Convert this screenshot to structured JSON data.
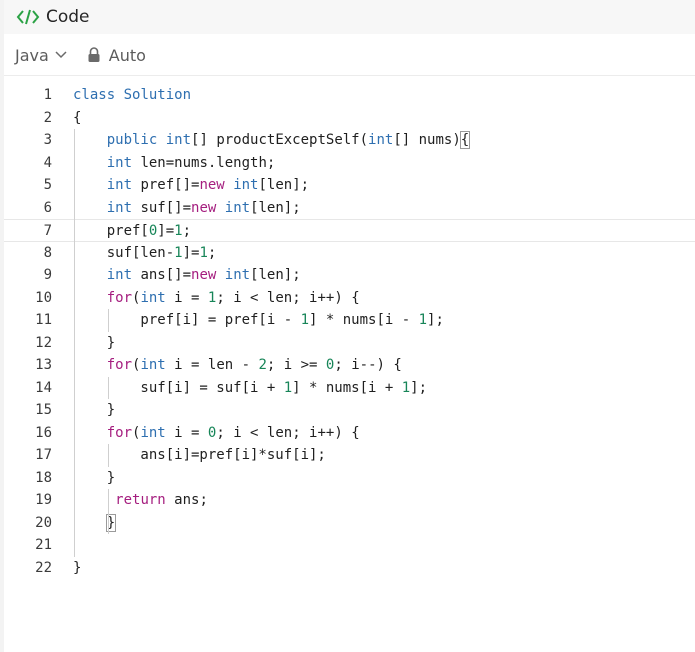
{
  "header": {
    "title": "Code",
    "icon": "code-brackets-icon",
    "icon_color": "#2ba245"
  },
  "toolbar": {
    "language": "Java",
    "mode": "Auto"
  },
  "editor": {
    "lines": [
      {
        "n": "1"
      },
      {
        "n": "2"
      },
      {
        "n": "3"
      },
      {
        "n": "4"
      },
      {
        "n": "5"
      },
      {
        "n": "6"
      },
      {
        "n": "7"
      },
      {
        "n": "8"
      },
      {
        "n": "9"
      },
      {
        "n": "10"
      },
      {
        "n": "11"
      },
      {
        "n": "12"
      },
      {
        "n": "13"
      },
      {
        "n": "14"
      },
      {
        "n": "15"
      },
      {
        "n": "16"
      },
      {
        "n": "17"
      },
      {
        "n": "18"
      },
      {
        "n": "19"
      },
      {
        "n": "20"
      },
      {
        "n": "21"
      },
      {
        "n": "22"
      }
    ],
    "tokens": [
      [
        [
          "kw",
          "class"
        ],
        [
          "",
          " "
        ],
        [
          "type",
          "Solution"
        ]
      ],
      [
        [
          "",
          "{"
        ]
      ],
      [
        [
          "",
          "    "
        ],
        [
          "kw",
          "public"
        ],
        [
          "",
          " "
        ],
        [
          "type",
          "int"
        ],
        [
          "",
          "[] productExceptSelf("
        ],
        [
          "type",
          "int"
        ],
        [
          "",
          "[] nums)"
        ],
        [
          "hl",
          "{"
        ]
      ],
      [
        [
          "",
          "    "
        ],
        [
          "type",
          "int"
        ],
        [
          "",
          " len=nums.length;"
        ]
      ],
      [
        [
          "",
          "    "
        ],
        [
          "type",
          "int"
        ],
        [
          "",
          " pref[]="
        ],
        [
          "kw2",
          "new"
        ],
        [
          "",
          " "
        ],
        [
          "type",
          "int"
        ],
        [
          "",
          "[len];"
        ]
      ],
      [
        [
          "",
          "    "
        ],
        [
          "type",
          "int"
        ],
        [
          "",
          " suf[]="
        ],
        [
          "kw2",
          "new"
        ],
        [
          "",
          " "
        ],
        [
          "type",
          "int"
        ],
        [
          "",
          "[len];"
        ]
      ],
      [
        [
          "",
          "    pref["
        ],
        [
          "num",
          "0"
        ],
        [
          "",
          "]="
        ],
        [
          "num",
          "1"
        ],
        [
          "",
          ";"
        ]
      ],
      [
        [
          "",
          "    suf[len-"
        ],
        [
          "num",
          "1"
        ],
        [
          "",
          "]="
        ],
        [
          "num",
          "1"
        ],
        [
          "",
          ";"
        ]
      ],
      [
        [
          "",
          "    "
        ],
        [
          "type",
          "int"
        ],
        [
          "",
          " ans[]="
        ],
        [
          "kw2",
          "new"
        ],
        [
          "",
          " "
        ],
        [
          "type",
          "int"
        ],
        [
          "",
          "[len];"
        ]
      ],
      [
        [
          "",
          "    "
        ],
        [
          "kw2",
          "for"
        ],
        [
          "",
          "("
        ],
        [
          "type",
          "int"
        ],
        [
          "",
          " i = "
        ],
        [
          "num",
          "1"
        ],
        [
          "",
          "; i < len; i++) {"
        ]
      ],
      [
        [
          "",
          "        pref[i] = pref[i - "
        ],
        [
          "num",
          "1"
        ],
        [
          "",
          "] * nums[i - "
        ],
        [
          "num",
          "1"
        ],
        [
          "",
          "];"
        ]
      ],
      [
        [
          "",
          "    }"
        ]
      ],
      [
        [
          "",
          "    "
        ],
        [
          "kw2",
          "for"
        ],
        [
          "",
          "("
        ],
        [
          "type",
          "int"
        ],
        [
          "",
          " i = len - "
        ],
        [
          "num",
          "2"
        ],
        [
          "",
          "; i >= "
        ],
        [
          "num",
          "0"
        ],
        [
          "",
          "; i--) {"
        ]
      ],
      [
        [
          "",
          "        suf[i] = suf[i + "
        ],
        [
          "num",
          "1"
        ],
        [
          "",
          "] * nums[i + "
        ],
        [
          "num",
          "1"
        ],
        [
          "",
          "];"
        ]
      ],
      [
        [
          "",
          "    }"
        ]
      ],
      [
        [
          "",
          "    "
        ],
        [
          "kw2",
          "for"
        ],
        [
          "",
          "("
        ],
        [
          "type",
          "int"
        ],
        [
          "",
          " i = "
        ],
        [
          "num",
          "0"
        ],
        [
          "",
          "; i < len; i++) {"
        ]
      ],
      [
        [
          "",
          "        ans[i]=pref[i]*suf[i];"
        ]
      ],
      [
        [
          "",
          "    }"
        ]
      ],
      [
        [
          "",
          "     "
        ],
        [
          "kw2",
          "return"
        ],
        [
          "",
          " ans;"
        ]
      ],
      [
        [
          "",
          "    "
        ],
        [
          "hl",
          "}"
        ]
      ],
      [
        [
          "",
          ""
        ]
      ],
      [
        [
          "",
          "}"
        ]
      ]
    ],
    "current_line": "7",
    "colors": {
      "keyword": "#2e6fb0",
      "control": "#a51e7f",
      "number": "#178558"
    }
  }
}
